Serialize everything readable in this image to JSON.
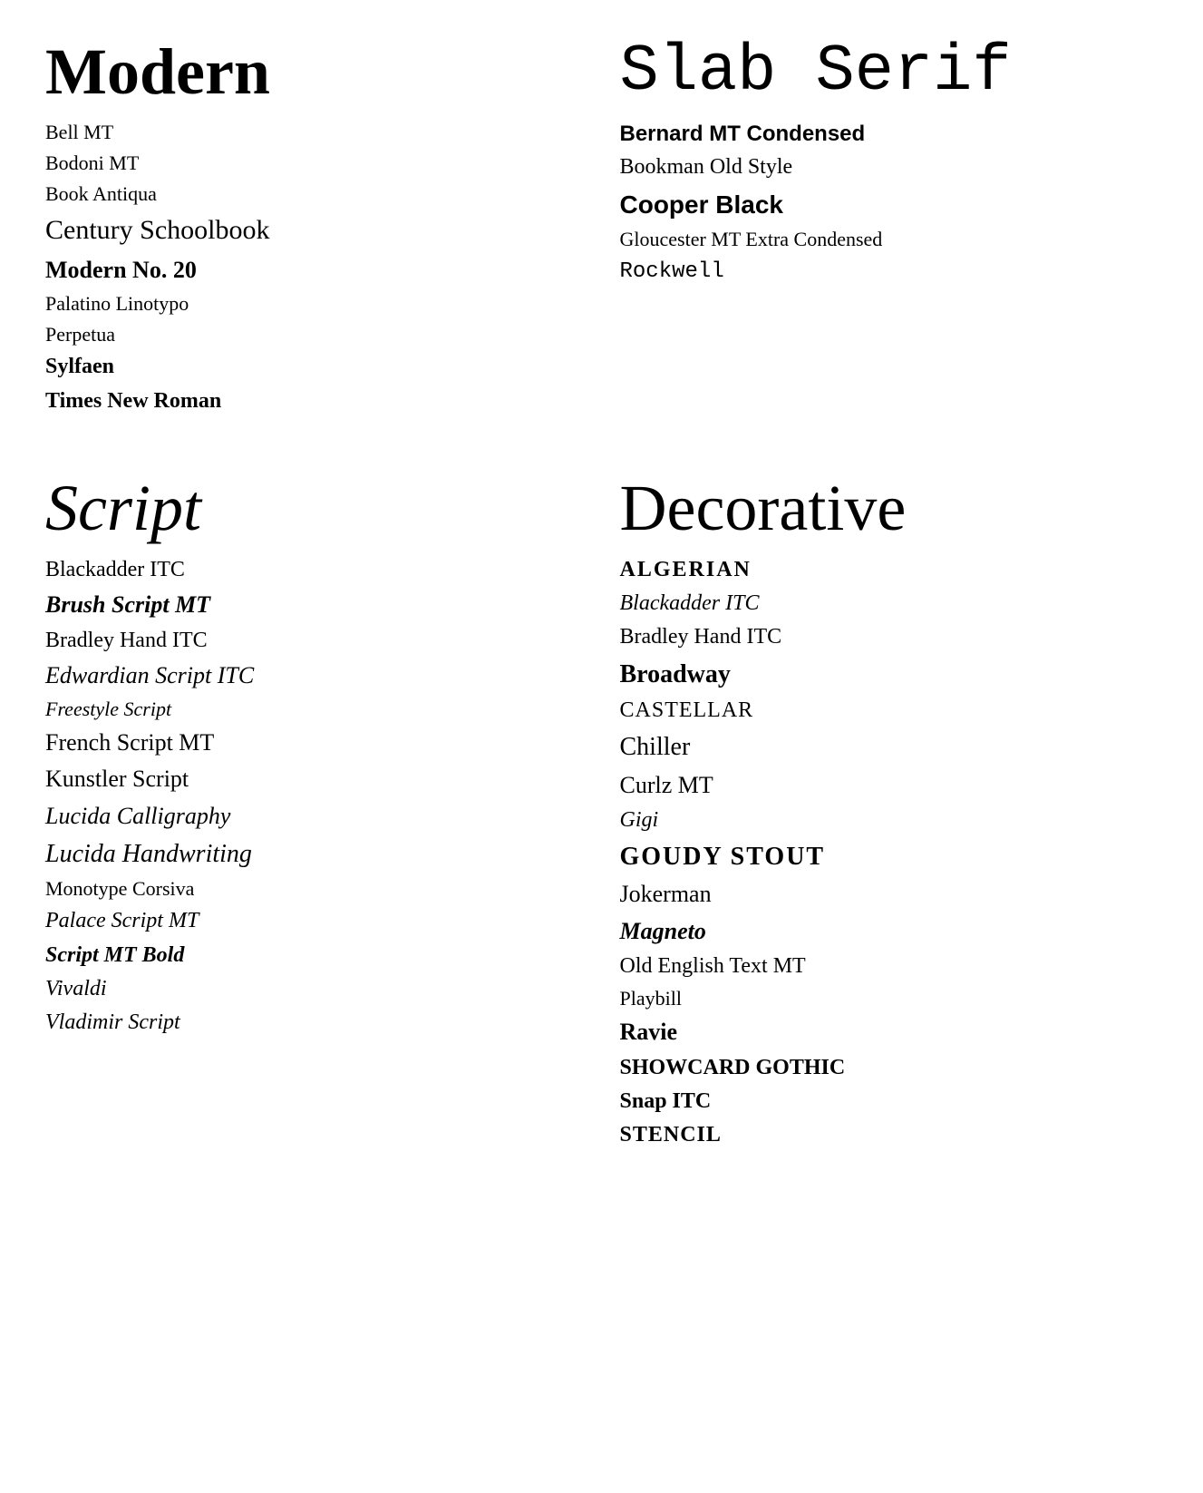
{
  "sections": {
    "modern": {
      "title": "Modern",
      "fonts": [
        {
          "name": "Bell MT",
          "class": "font-bell-mt"
        },
        {
          "name": "Bodoni MT",
          "class": "font-bodoni-mt"
        },
        {
          "name": "Book Antiqua",
          "class": "font-book-antiqua"
        },
        {
          "name": "Century Schoolbook",
          "class": "font-century-schoolbook"
        },
        {
          "name": "Modern No. 20",
          "class": "font-modern-no20"
        },
        {
          "name": "Palatino Linotypo",
          "class": "font-palatino"
        },
        {
          "name": "Perpetua",
          "class": "font-perpetua"
        },
        {
          "name": "Sylfaen",
          "class": "font-sylfaen"
        },
        {
          "name": "Times New Roman",
          "class": "font-times"
        }
      ]
    },
    "slab_serif": {
      "title": "Slab Serif",
      "fonts": [
        {
          "name": "Bernard MT Condensed",
          "class": "font-bernard"
        },
        {
          "name": "Bookman Old Style",
          "class": "font-bookman"
        },
        {
          "name": "Cooper Black",
          "class": "font-cooper-black"
        },
        {
          "name": "Gloucester MT Extra Condensed",
          "class": "font-gloucester"
        },
        {
          "name": "Rockwell",
          "class": "font-rockwell"
        }
      ]
    },
    "script": {
      "title": "Script",
      "fonts": [
        {
          "name": "Blackadder ITC",
          "class": "font-blackadder"
        },
        {
          "name": "Brush Script MT",
          "class": "font-brush-script"
        },
        {
          "name": "Bradley Hand ITC",
          "class": "font-bradley-hand"
        },
        {
          "name": "Edwardian Script ITC",
          "class": "font-edwardian"
        },
        {
          "name": "Freestyle Script",
          "class": "font-freestyle"
        },
        {
          "name": "French Script MT",
          "class": "font-french-script"
        },
        {
          "name": "Kunstler Script",
          "class": "font-kunstler"
        },
        {
          "name": "Lucida Calligraphy",
          "class": "font-lucida-cal"
        },
        {
          "name": "Lucida Handwriting",
          "class": "font-lucida-hand"
        },
        {
          "name": "Monotype Corsiva",
          "class": "font-monotype-corsiva"
        },
        {
          "name": "Palace Script MT",
          "class": "font-palace-script"
        },
        {
          "name": "Script MT Bold",
          "class": "font-script-mt-bold"
        },
        {
          "name": "Vivaldi",
          "class": "font-vivaldi"
        },
        {
          "name": "Vladimir Script",
          "class": "font-vladimir"
        }
      ]
    },
    "decorative": {
      "title": "Decorative",
      "fonts": [
        {
          "name": "ALGERIAN",
          "class": "font-algerian"
        },
        {
          "name": "Blackadder ITC",
          "class": "font-blackadder-dec"
        },
        {
          "name": "Bradley Hand ITC",
          "class": "font-bradley-dec"
        },
        {
          "name": "Broadway",
          "class": "font-broadway"
        },
        {
          "name": "CASTELLAR",
          "class": "font-castellar"
        },
        {
          "name": "Chiller",
          "class": "font-chiller"
        },
        {
          "name": "Curlz MT",
          "class": "font-curlz"
        },
        {
          "name": "Gigi",
          "class": "font-gigi"
        },
        {
          "name": "GOUDY STOUT",
          "class": "font-goudy-stout"
        },
        {
          "name": "Jokerman",
          "class": "font-jokerman"
        },
        {
          "name": "Magneto",
          "class": "font-magneto"
        },
        {
          "name": "Old English Text MT",
          "class": "font-old-english"
        },
        {
          "name": "Playbill",
          "class": "font-playbill"
        },
        {
          "name": "Ravie",
          "class": "font-ravie"
        },
        {
          "name": "SHOWCARD GOTHIC",
          "class": "font-showcard"
        },
        {
          "name": "Snap ITC",
          "class": "font-snap-itc"
        },
        {
          "name": "STENCIL",
          "class": "font-stencil"
        }
      ]
    }
  }
}
